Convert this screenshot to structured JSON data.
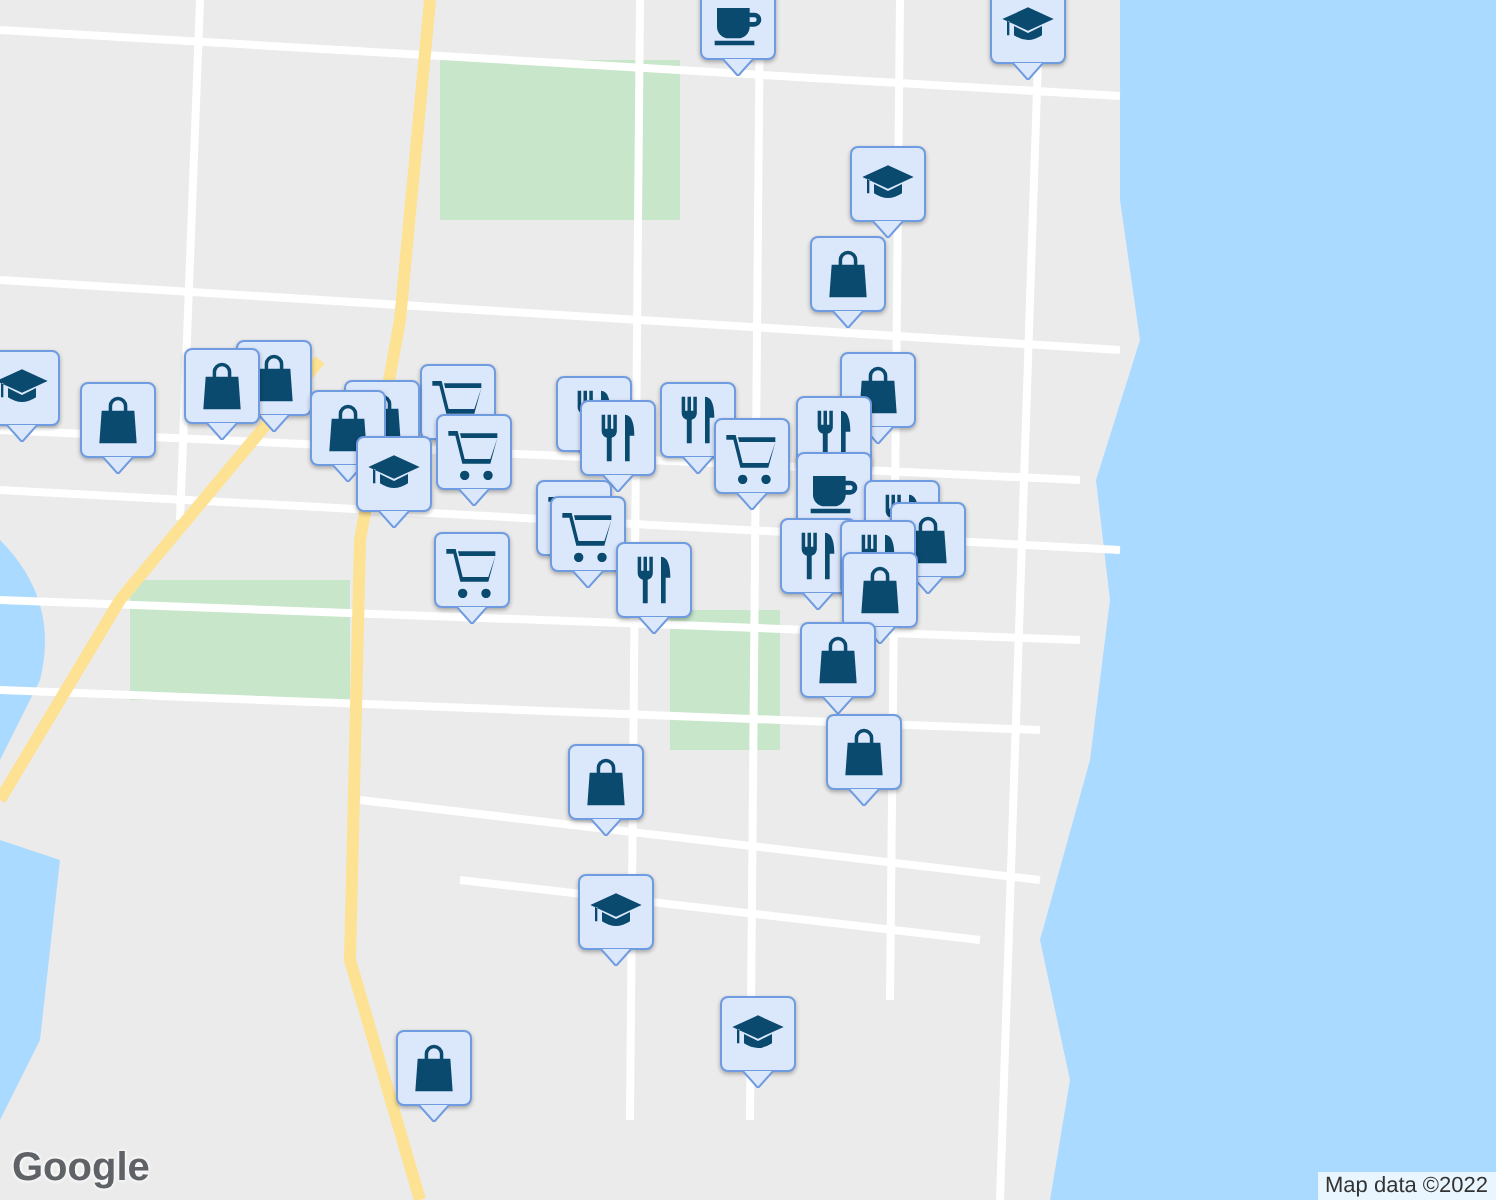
{
  "map": {
    "markers": [
      {
        "kind": "coffee"
      },
      {
        "kind": "school"
      },
      {
        "kind": "school"
      },
      {
        "kind": "shopping"
      },
      {
        "kind": "school"
      },
      {
        "kind": "shopping"
      },
      {
        "kind": "shopping"
      },
      {
        "kind": "shopping"
      },
      {
        "kind": "grocery"
      },
      {
        "kind": "shopping"
      },
      {
        "kind": "shopping"
      },
      {
        "kind": "school"
      },
      {
        "kind": "grocery"
      },
      {
        "kind": "food"
      },
      {
        "kind": "food"
      },
      {
        "kind": "food"
      },
      {
        "kind": "grocery"
      },
      {
        "kind": "shopping"
      },
      {
        "kind": "food"
      },
      {
        "kind": "coffee"
      },
      {
        "kind": "food"
      },
      {
        "kind": "shopping"
      },
      {
        "kind": "grocery"
      },
      {
        "kind": "grocery"
      },
      {
        "kind": "grocery"
      },
      {
        "kind": "food"
      },
      {
        "kind": "food"
      },
      {
        "kind": "food"
      },
      {
        "kind": "shopping"
      },
      {
        "kind": "shopping"
      },
      {
        "kind": "shopping"
      },
      {
        "kind": "shopping"
      },
      {
        "kind": "school"
      },
      {
        "kind": "school"
      },
      {
        "kind": "shopping"
      }
    ]
  },
  "logo": "Google",
  "attribution": "Map data ©2022"
}
